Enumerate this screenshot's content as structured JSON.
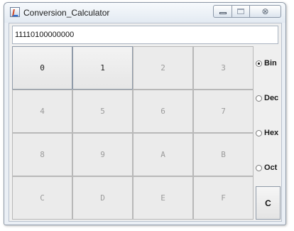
{
  "window": {
    "title": "Conversion_Calculator",
    "controls": {
      "minimize_icon": "minimize-icon",
      "maximize_icon": "maximize-icon",
      "close_glyph": "⊗",
      "close_icon": "close-icon"
    }
  },
  "display": {
    "value": "11110100000000"
  },
  "keypad": {
    "rows": [
      [
        {
          "label": "0",
          "enabled": true
        },
        {
          "label": "1",
          "enabled": true
        },
        {
          "label": "2",
          "enabled": false
        },
        {
          "label": "3",
          "enabled": false
        }
      ],
      [
        {
          "label": "4",
          "enabled": false
        },
        {
          "label": "5",
          "enabled": false
        },
        {
          "label": "6",
          "enabled": false
        },
        {
          "label": "7",
          "enabled": false
        }
      ],
      [
        {
          "label": "8",
          "enabled": false
        },
        {
          "label": "9",
          "enabled": false
        },
        {
          "label": "A",
          "enabled": false
        },
        {
          "label": "B",
          "enabled": false
        }
      ],
      [
        {
          "label": "C",
          "enabled": false
        },
        {
          "label": "D",
          "enabled": false
        },
        {
          "label": "E",
          "enabled": false
        },
        {
          "label": "F",
          "enabled": false
        }
      ]
    ]
  },
  "modes": [
    {
      "label": "Bin",
      "checked": true
    },
    {
      "label": "Dec",
      "checked": false
    },
    {
      "label": "Hex",
      "checked": false
    },
    {
      "label": "Oct",
      "checked": false
    }
  ],
  "clear_button": {
    "label": "C"
  },
  "colors": {
    "window_frame": "#eaeff5",
    "panel": "#efefef",
    "key_enabled_text": "#1c1c1c",
    "key_disabled_text": "#9b9b9b"
  }
}
